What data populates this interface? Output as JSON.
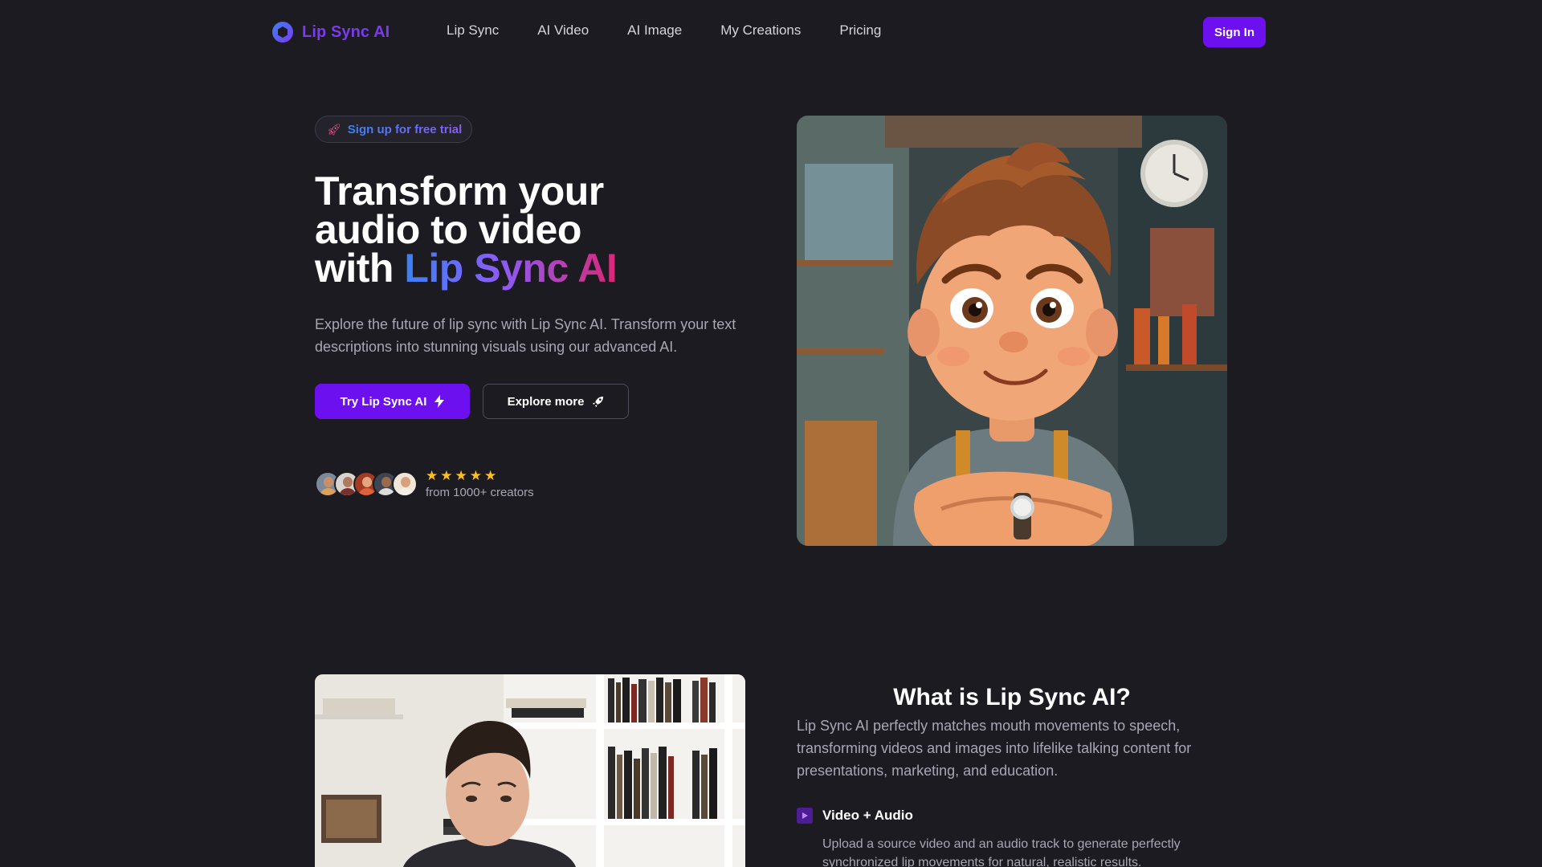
{
  "nav": {
    "brand": "Lip Sync AI",
    "links": [
      "Lip Sync",
      "AI Video",
      "AI Image",
      "My Creations",
      "Pricing"
    ],
    "sign_in": "Sign In"
  },
  "hero": {
    "badge_icon": "rocket-icon",
    "badge_text": "Sign up for free trial",
    "title_line1": "Transform your",
    "title_line2": "audio to video",
    "title_line3_prefix": "with ",
    "title_highlight": "Lip Sync AI",
    "description": "Explore the future of lip sync with Lip Sync AI. Transform your text descriptions into stunning visuals using our advanced AI.",
    "primary_button": "Try Lip Sync AI",
    "primary_icon": "bolt-icon",
    "secondary_button": "Explore more",
    "secondary_icon": "rocket-icon",
    "rating_stars": 5,
    "rating_text": "from 1000+ creators"
  },
  "about": {
    "title": "What is Lip Sync AI?",
    "description": "Lip Sync AI perfectly matches mouth movements to speech, transforming videos and images into lifelike talking content for presentations, marketing, and education.",
    "feature_icon": "play-square-icon",
    "feature_title": "Video + Audio",
    "feature_description": "Upload a source video and an audio track to generate perfectly synchronized lip movements for natural, realistic results."
  },
  "colors": {
    "background": "#1c1b21",
    "accent": "#6d10f0",
    "star": "#fbbf24"
  }
}
